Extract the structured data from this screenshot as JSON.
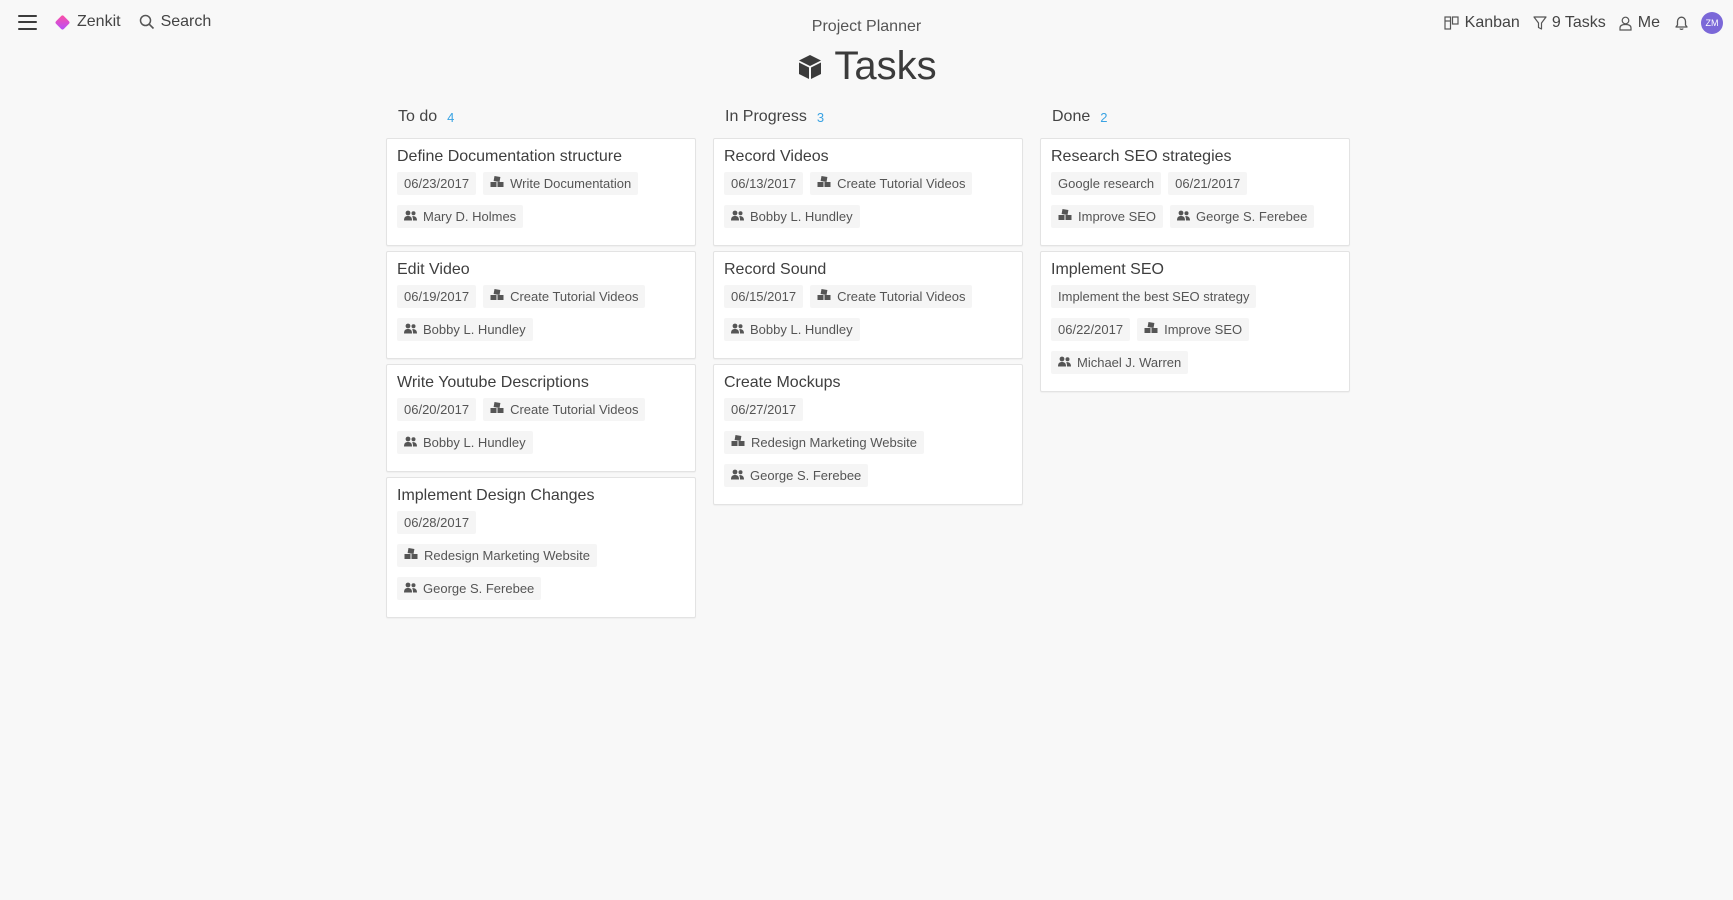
{
  "header": {
    "app_name": "Zenkit",
    "search_label": "Search",
    "project_title": "Project Planner",
    "view_label": "Kanban",
    "filter_label": "9 Tasks",
    "me_label": "Me",
    "avatar_initials": "ZM"
  },
  "page": {
    "title": "Tasks"
  },
  "colors": {
    "accent": "#3aa3e3",
    "avatar": "#7b68d8",
    "logo_gradient_start": "#ff4fa0",
    "logo_gradient_end": "#b44fff"
  },
  "columns": [
    {
      "name": "To do",
      "count": "4",
      "cards": [
        {
          "title": "Define Documentation structure",
          "rows": [
            [
              {
                "text": "06/23/2017",
                "icon": ""
              },
              {
                "text": "Write Documentation",
                "icon": "project-icon"
              }
            ],
            [
              {
                "text": "Mary D. Holmes",
                "icon": "users-icon"
              }
            ]
          ]
        },
        {
          "title": "Edit Video",
          "rows": [
            [
              {
                "text": "06/19/2017",
                "icon": ""
              },
              {
                "text": "Create Tutorial Videos",
                "icon": "project-icon"
              }
            ],
            [
              {
                "text": "Bobby L. Hundley",
                "icon": "users-icon"
              }
            ]
          ]
        },
        {
          "title": "Write Youtube Descriptions",
          "rows": [
            [
              {
                "text": "06/20/2017",
                "icon": ""
              },
              {
                "text": "Create Tutorial Videos",
                "icon": "project-icon"
              }
            ],
            [
              {
                "text": "Bobby L. Hundley",
                "icon": "users-icon"
              }
            ]
          ]
        },
        {
          "title": "Implement Design Changes",
          "rows": [
            [
              {
                "text": "06/28/2017",
                "icon": ""
              }
            ],
            [
              {
                "text": "Redesign Marketing Website",
                "icon": "project-icon"
              }
            ],
            [
              {
                "text": "George S. Ferebee",
                "icon": "users-icon"
              }
            ]
          ]
        }
      ]
    },
    {
      "name": "In Progress",
      "count": "3",
      "cards": [
        {
          "title": "Record Videos",
          "rows": [
            [
              {
                "text": "06/13/2017",
                "icon": ""
              },
              {
                "text": "Create Tutorial Videos",
                "icon": "project-icon"
              }
            ],
            [
              {
                "text": "Bobby L. Hundley",
                "icon": "users-icon"
              }
            ]
          ]
        },
        {
          "title": "Record Sound",
          "rows": [
            [
              {
                "text": "06/15/2017",
                "icon": ""
              },
              {
                "text": "Create Tutorial Videos",
                "icon": "project-icon"
              }
            ],
            [
              {
                "text": "Bobby L. Hundley",
                "icon": "users-icon"
              }
            ]
          ]
        },
        {
          "title": "Create Mockups",
          "rows": [
            [
              {
                "text": "06/27/2017",
                "icon": ""
              }
            ],
            [
              {
                "text": "Redesign Marketing Website",
                "icon": "project-icon"
              }
            ],
            [
              {
                "text": "George S. Ferebee",
                "icon": "users-icon"
              }
            ]
          ]
        }
      ]
    },
    {
      "name": "Done",
      "count": "2",
      "cards": [
        {
          "title": "Research SEO strategies",
          "rows": [
            [
              {
                "text": "Google research",
                "icon": ""
              },
              {
                "text": "06/21/2017",
                "icon": ""
              }
            ],
            [
              {
                "text": "Improve SEO",
                "icon": "project-icon"
              },
              {
                "text": "George S. Ferebee",
                "icon": "users-icon"
              }
            ]
          ]
        },
        {
          "title": "Implement SEO",
          "rows": [
            [
              {
                "text": "Implement the best SEO strategy",
                "icon": ""
              }
            ],
            [
              {
                "text": "06/22/2017",
                "icon": ""
              },
              {
                "text": "Improve SEO",
                "icon": "project-icon"
              }
            ],
            [
              {
                "text": "Michael J. Warren",
                "icon": "users-icon"
              }
            ]
          ]
        }
      ]
    }
  ]
}
